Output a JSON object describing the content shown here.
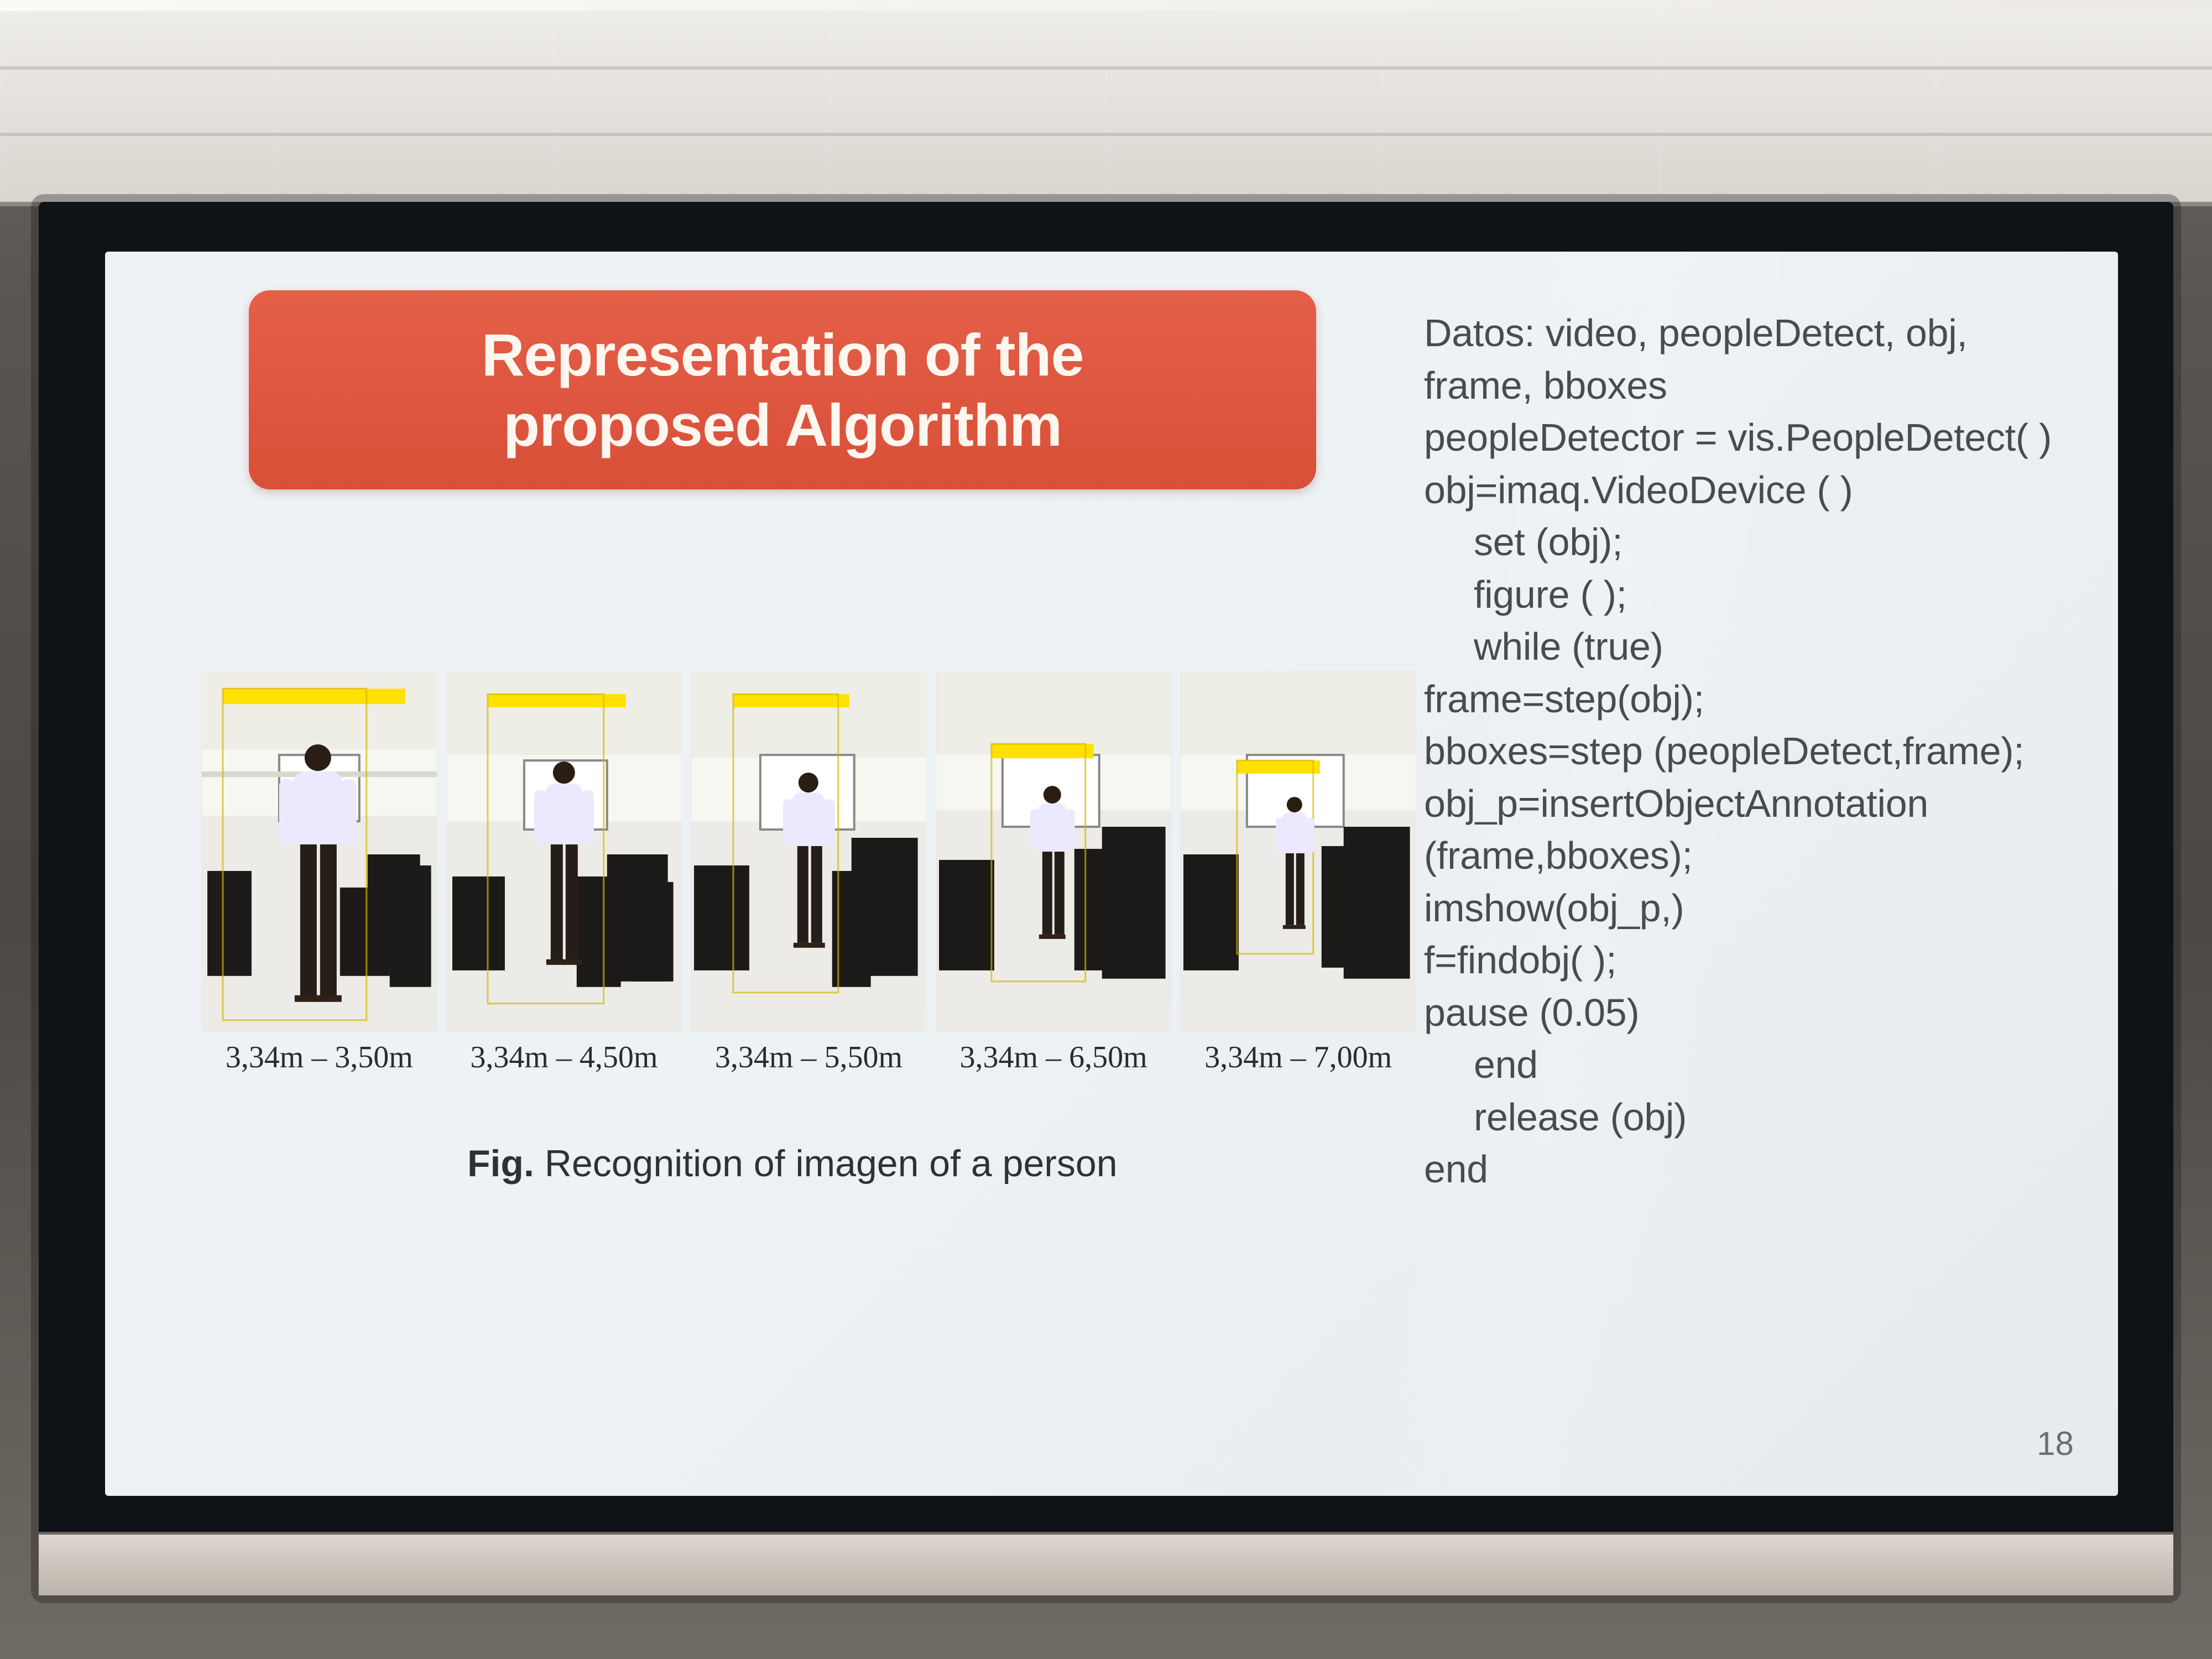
{
  "slide": {
    "title": "Representation of the proposed Algorithm",
    "figure_caption": {
      "prefix": "Fig.",
      "text": "Recognition of imagen of a person"
    },
    "distance_labels": [
      "3,34m – 3,50m",
      "3,34m – 4,50m",
      "3,34m – 5,50m",
      "3,34m – 6,50m",
      "3,34m – 7,00m"
    ],
    "code_lines": [
      "Datos: video, peopleDetect, obj,",
      "frame, bboxes",
      "peopleDetector = vis.PeopleDetect( )",
      "obj=imaq.VideoDevice ( )",
      "set (obj);",
      "figure ( );",
      "while (true)",
      "frame=step(obj);",
      "bboxes=step (peopleDetect,frame);",
      "obj_p=insertObjectAnnotation",
      "(frame,bboxes);",
      "imshow(obj_p,)",
      "f=findobj( );",
      "pause (0.05)",
      "end",
      "release (obj)",
      "end"
    ],
    "page_number": "18",
    "colors": {
      "title_background": "#d94f38",
      "slide_background": "#edf2f5",
      "code_text": "#484b50"
    }
  }
}
